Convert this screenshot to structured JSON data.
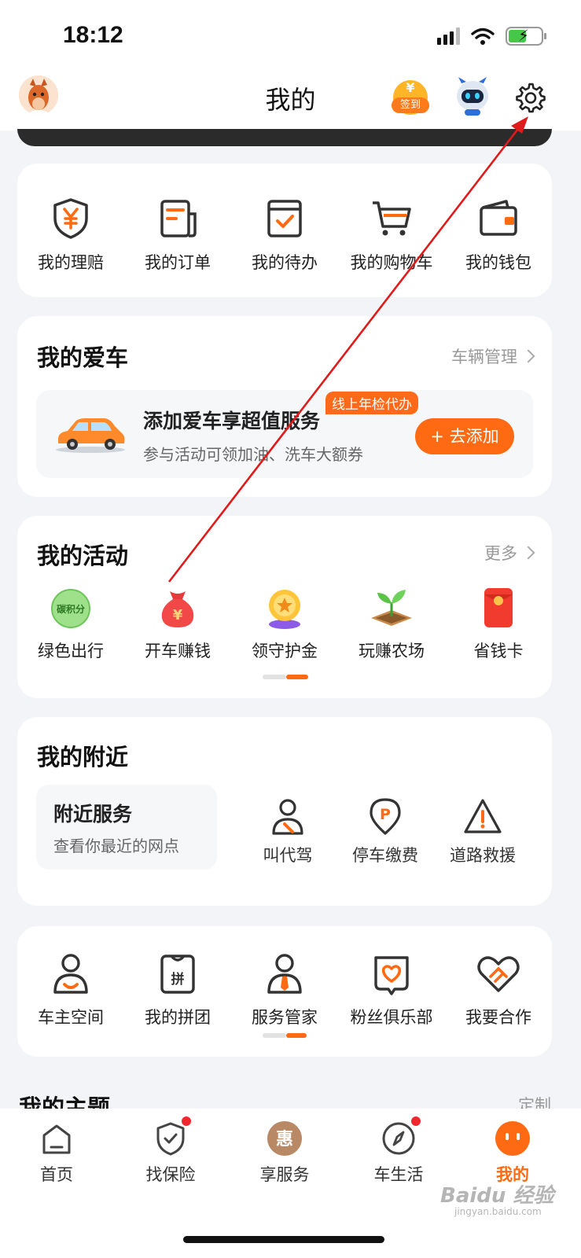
{
  "status": {
    "time": "18:12"
  },
  "header": {
    "title": "我的",
    "signin_label": "签到",
    "signin_symbol": "¥"
  },
  "services": [
    {
      "label": "我的理赔",
      "icon": "shield-yen-icon"
    },
    {
      "label": "我的订单",
      "icon": "order-icon"
    },
    {
      "label": "我的待办",
      "icon": "todo-check-icon"
    },
    {
      "label": "我的购物车",
      "icon": "cart-icon"
    },
    {
      "label": "我的钱包",
      "icon": "wallet-icon"
    }
  ],
  "my_car": {
    "title": "我的爱车",
    "manage_link": "车辆管理",
    "promo_title": "添加爱车享超值服务",
    "promo_sub": "参与活动可领加油、洗车大额券",
    "tag": "线上年检代办",
    "add_button": "+ 去添加"
  },
  "activities": {
    "title": "我的活动",
    "more_link": "更多",
    "items": [
      {
        "label": "绿色出行",
        "icon": "carbon-points-icon",
        "icon_text": "碳积分"
      },
      {
        "label": "开车赚钱",
        "icon": "money-bag-icon"
      },
      {
        "label": "领守护金",
        "icon": "gold-medal-icon"
      },
      {
        "label": "玩赚农场",
        "icon": "sprout-icon"
      },
      {
        "label": "省钱卡",
        "icon": "red-envelope-icon"
      }
    ]
  },
  "nearby": {
    "title": "我的附近",
    "box_title": "附近服务",
    "box_sub": "查看你最近的网点",
    "items": [
      {
        "label": "叫代驾",
        "icon": "driver-icon"
      },
      {
        "label": "停车缴费",
        "icon": "parking-icon"
      },
      {
        "label": "道路救援",
        "icon": "warning-icon"
      }
    ]
  },
  "more_services": [
    {
      "label": "车主空间",
      "icon": "user-space-icon"
    },
    {
      "label": "我的拼团",
      "icon": "group-buy-icon",
      "icon_text": "拼"
    },
    {
      "label": "服务管家",
      "icon": "butler-icon"
    },
    {
      "label": "粉丝俱乐部",
      "icon": "fan-club-icon"
    },
    {
      "label": "我要合作",
      "icon": "handshake-icon"
    }
  ],
  "theme_section": {
    "title": "我的主题",
    "link": "定制"
  },
  "tabs": [
    {
      "label": "首页",
      "icon": "home-icon"
    },
    {
      "label": "找保险",
      "icon": "insurance-shield-icon"
    },
    {
      "label": "享服务",
      "icon": "hui-icon",
      "icon_text": "惠"
    },
    {
      "label": "车生活",
      "icon": "compass-icon"
    },
    {
      "label": "我的",
      "icon": "mine-face-icon"
    }
  ],
  "watermark": {
    "brand": "Baidu 经验",
    "url": "jingyan.baidu.com"
  },
  "colors": {
    "accent": "#ff6a12",
    "annotation_arrow": "#e01b1b"
  }
}
